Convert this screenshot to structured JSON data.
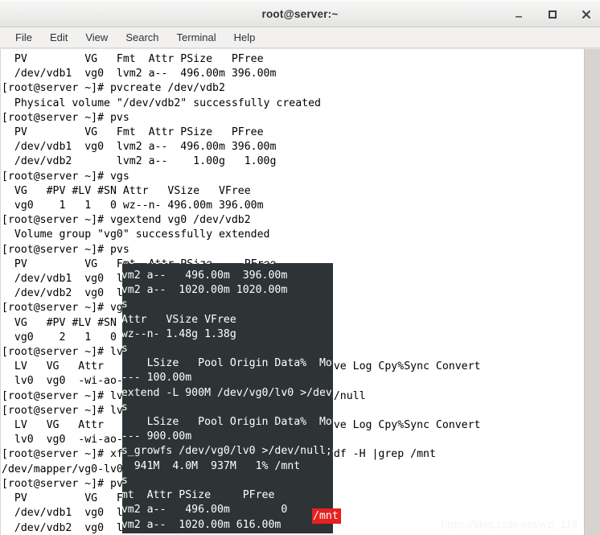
{
  "window": {
    "title": "root@server:~",
    "buttons": {
      "minimize": "minimize-button",
      "maximize": "maximize-button",
      "close": "close-button"
    }
  },
  "menubar": {
    "items": [
      {
        "label": "File"
      },
      {
        "label": "Edit"
      },
      {
        "label": "View"
      },
      {
        "label": "Search"
      },
      {
        "label": "Terminal"
      },
      {
        "label": "Help"
      }
    ]
  },
  "terminal": {
    "prompt": "[root@server ~]#",
    "colors": {
      "background": "#ffffff",
      "foreground": "#000000",
      "selection_background": "#2e3436",
      "selection_foreground": "#ffffff",
      "grep_match_background": "#e8201f",
      "grep_match_foreground": "#ffffff"
    },
    "screen_text": "  PV         VG   Fmt  Attr PSize   PFree\n  /dev/vdb1  vg0  lvm2 a--  496.00m 396.00m\n[root@server ~]# pvcreate /dev/vdb2\n  Physical volume \"/dev/vdb2\" successfully created\n[root@server ~]# pvs\n  PV         VG   Fmt  Attr PSize   PFree\n  /dev/vdb1  vg0  lvm2 a--  496.00m 396.00m\n  /dev/vdb2       lvm2 a--    1.00g   1.00g\n[root@server ~]# vgs\n  VG   #PV #LV #SN Attr   VSize   VFree\n  vg0    1   1   0 wz--n- 496.00m 396.00m\n[root@server ~]# vgextend vg0 /dev/vdb2\n  Volume group \"vg0\" successfully extended\n[root@server ~]# pvs\n  PV         VG   Fmt  Attr PSize     PFree\n  /dev/vdb1  vg0  lvm2 a--   496.00m  396.00m\n  /dev/vdb2  vg0  lvm2 a--  1020.00m 1020.00m\n[root@server ~]# vgs\n  VG   #PV #LV #SN Attr   VSize VFree\n  vg0    2   1   0 wz--n- 1.48g 1.38g\n[root@server ~]# lvs\n  LV   VG   Attr       LSize   Pool Origin Data%  Move Log Cpy%Sync Convert\n  lv0  vg0  -wi-ao---- 100.00m\n[root@server ~]# lvextend -L 900M /dev/vg0/lv0 >/dev/null\n[root@server ~]# lvs\n  LV   VG   Attr       LSize   Pool Origin Data%  Move Log Cpy%Sync Convert\n  lv0  vg0  -wi-ao---- 900.00m\n[root@server ~]# xfs_growfs /dev/vg0/lv0 >/dev/null;df -H |grep /mnt\n/dev/mapper/vg0-lv0  941M  4.0M  937M   1% /mnt\n[root@server ~]# pvs\n  PV         VG   Fmt  Attr PSize     PFree\n  /dev/vdb1  vg0  lvm2 a--   496.00m        0\n  /dev/vdb2  vg0  lvm2 a--  1020.00m 616.00m",
    "grep_match": "/mnt",
    "commands": [
      "pvcreate /dev/vdb2",
      "pvs",
      "vgs",
      "vgextend vg0 /dev/vdb2",
      "pvs",
      "vgs",
      "lvs",
      "lvextend -L 900M /dev/vg0/lv0 >/dev/null",
      "lvs",
      "xfs_growfs /dev/vg0/lv0 >/dev/null;df -H |grep /mnt",
      "pvs"
    ]
  },
  "watermark": {
    "text": "https://blog.csdn.net/wzl_119"
  }
}
